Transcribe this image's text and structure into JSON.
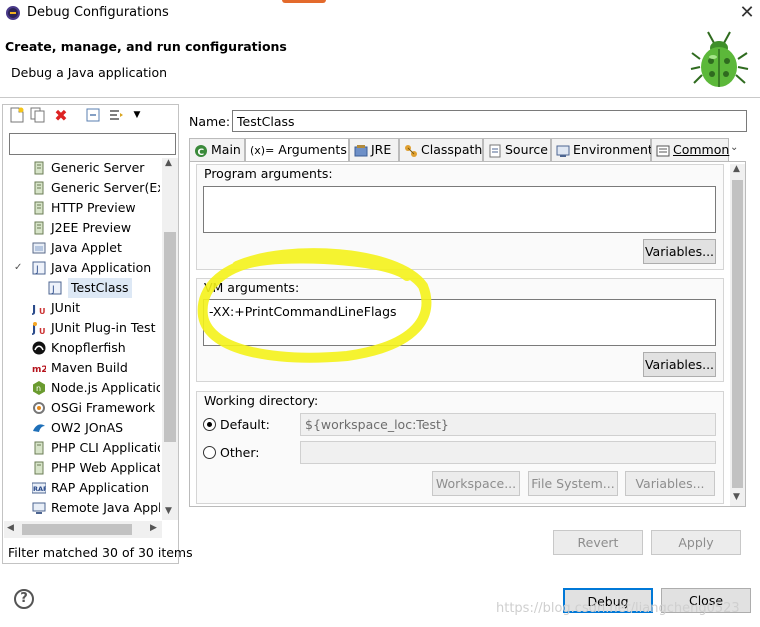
{
  "window": {
    "title": "Debug Configurations",
    "close_glyph": "✕"
  },
  "header": {
    "title": "Create, manage, and run configurations",
    "subtitle": "Debug a Java application"
  },
  "left": {
    "filter_placeholder": "",
    "tree": [
      {
        "label": "Generic Server",
        "icon": "server-icon"
      },
      {
        "label": "Generic Server(Exte",
        "icon": "server-icon"
      },
      {
        "label": "HTTP Preview",
        "icon": "server-icon"
      },
      {
        "label": "J2EE Preview",
        "icon": "server-icon"
      },
      {
        "label": "Java Applet",
        "icon": "applet-icon"
      },
      {
        "label": "Java Application",
        "icon": "java-app-icon",
        "expanded": true
      },
      {
        "label": "TestClass",
        "icon": "java-class-icon",
        "selected": true
      },
      {
        "label": "JUnit",
        "icon": "junit-icon"
      },
      {
        "label": "JUnit Plug-in Test",
        "icon": "junit-plugin-icon"
      },
      {
        "label": "Knopflerfish",
        "icon": "knopflerfish-icon"
      },
      {
        "label": "Maven Build",
        "icon": "maven-icon"
      },
      {
        "label": "Node.js Application",
        "icon": "nodejs-icon"
      },
      {
        "label": "OSGi Framework",
        "icon": "osgi-icon"
      },
      {
        "label": "OW2 JOnAS",
        "icon": "jonas-icon"
      },
      {
        "label": "PHP CLI Application",
        "icon": "php-icon"
      },
      {
        "label": "PHP Web Applicati",
        "icon": "php-icon"
      },
      {
        "label": "RAP Application",
        "icon": "rap-icon"
      },
      {
        "label": "Remote Java Appli",
        "icon": "remote-java-icon"
      }
    ],
    "filter_status": "Filter matched 30 of 30 items"
  },
  "config": {
    "name_label": "Name:",
    "name_value": "TestClass",
    "tabs": [
      "Main",
      "Arguments",
      "JRE",
      "Classpath",
      "Source",
      "Environment",
      "Common"
    ],
    "active_tab": "Arguments",
    "program_args_label": "Program arguments:",
    "program_args_value": "",
    "variables_label": "Variables...",
    "vm_args_label": "VM arguments:",
    "vm_args_value": "-XX:+PrintCommandLineFlags",
    "working_dir_label": "Working directory:",
    "default_label": "Default:",
    "default_value": "${workspace_loc:Test}",
    "other_label": "Other:",
    "workspace_label": "Workspace...",
    "filesystem_label": "File System...",
    "revert_label": "Revert",
    "apply_label": "Apply"
  },
  "footer": {
    "help_glyph": "?",
    "debug_label": "Debug",
    "close_label": "Close",
    "watermark": "https://blog.csdn.net/liangcheng0523"
  },
  "colors": {
    "highlight": "#f4f21a",
    "selection": "#dde8f5"
  }
}
